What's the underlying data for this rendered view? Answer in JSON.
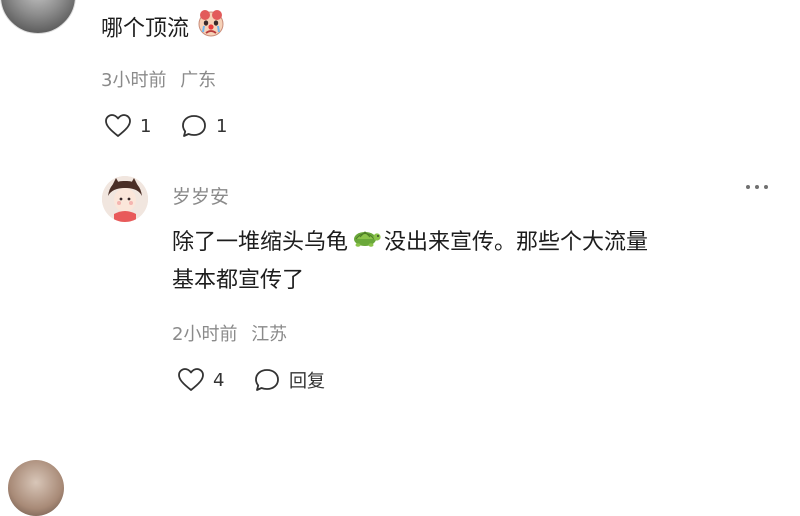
{
  "comment": {
    "text": "哪个顶流",
    "emoji_icon": "crying-clown-emoji",
    "time": "3小时前",
    "location": "广东",
    "likes": "1",
    "replies": "1"
  },
  "reply": {
    "username": "岁岁安",
    "text_part1": "除了一堆缩头乌龟",
    "emoji_icon": "turtle-emoji",
    "text_part2": "没出来宣传。那些个大流量",
    "text_line2": "基本都宣传了",
    "time": "2小时前",
    "location": "江苏",
    "likes": "4",
    "reply_label": "回复"
  },
  "colors": {
    "meta_gray": "#8a8a8a",
    "text_dark": "#1d1d1d"
  }
}
